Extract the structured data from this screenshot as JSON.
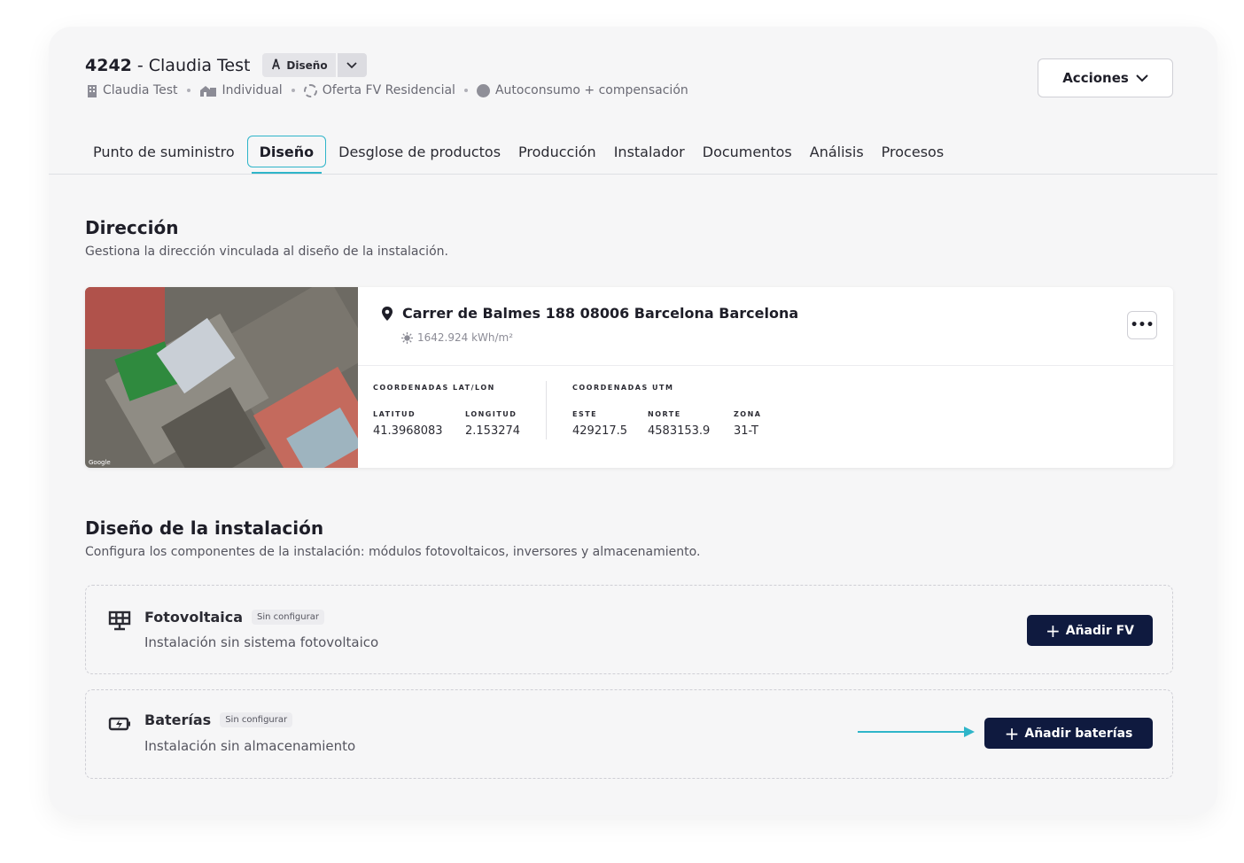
{
  "header": {
    "project_id": "4242",
    "separator": "-",
    "project_name": "Claudia Test",
    "stage_label": "Diseño",
    "meta": [
      {
        "icon": "building-icon",
        "label": "Claudia Test"
      },
      {
        "icon": "house-icon",
        "label": "Individual"
      },
      {
        "icon": "dashed-circle-icon",
        "label": "Oferta FV Residencial"
      },
      {
        "icon": "filled-circle-icon",
        "label": "Autoconsumo + compensación"
      }
    ],
    "actions_label": "Acciones"
  },
  "tabs": [
    {
      "label": "Punto de suministro",
      "active": false
    },
    {
      "label": "Diseño",
      "active": true
    },
    {
      "label": "Desglose de productos",
      "active": false
    },
    {
      "label": "Producción",
      "active": false
    },
    {
      "label": "Instalador",
      "active": false
    },
    {
      "label": "Documentos",
      "active": false
    },
    {
      "label": "Análisis",
      "active": false
    },
    {
      "label": "Procesos",
      "active": false
    }
  ],
  "direccion": {
    "title": "Dirección",
    "subtitle": "Gestiona la dirección vinculada al diseño de la instalación.",
    "address": "Carrer de Balmes 188 08006 Barcelona Barcelona",
    "irradiance": "1642.924 kWh/m²",
    "map_caption": "Google",
    "latlon_label": "COORDENADAS LAT/LON",
    "utm_label": "COORDENADAS UTM",
    "latitud_label": "LATITUD",
    "latitud": "41.3968083",
    "longitud_label": "LONGITUD",
    "longitud": "2.153274",
    "este_label": "ESTE",
    "este": "429217.5",
    "norte_label": "NORTE",
    "norte": "4583153.9",
    "zona_label": "ZONA",
    "zona": "31-T"
  },
  "diseno": {
    "title": "Diseño de la instalación",
    "subtitle": "Configura los componentes de la instalación: módulos fotovoltaicos, inversores y almacenamiento.",
    "fv": {
      "title": "Fotovoltaica",
      "badge": "Sin configurar",
      "description": "Instalación sin sistema fotovoltaico",
      "button": "Añadir FV"
    },
    "baterias": {
      "title": "Baterías",
      "badge": "Sin configurar",
      "description": "Instalación sin almacenamiento",
      "button": "Añadir baterías"
    }
  },
  "colors": {
    "accent": "#2fb5c9",
    "primary_button": "#0f1a3f"
  }
}
